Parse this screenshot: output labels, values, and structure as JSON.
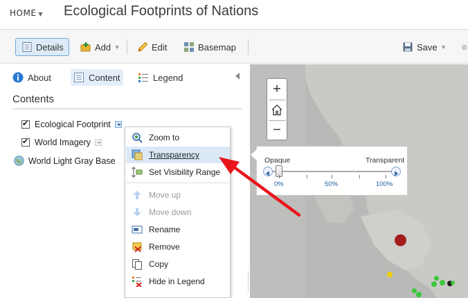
{
  "header": {
    "home_label": "HOME",
    "title": "Ecological Footprints of Nations"
  },
  "toolbar": {
    "details_label": "Details",
    "add_label": "Add",
    "edit_label": "Edit",
    "basemap_label": "Basemap",
    "save_label": "Save"
  },
  "panel": {
    "tabs": {
      "about": "About",
      "content": "Content",
      "legend": "Legend"
    },
    "section_title": "Contents",
    "layers": [
      {
        "name": "Ecological Footprint",
        "checked": true
      },
      {
        "name": "World Imagery",
        "checked": true
      },
      {
        "name": "World Light Gray Base"
      }
    ]
  },
  "context_menu": {
    "items": [
      {
        "label": "Zoom to",
        "icon": "zoom-to-icon",
        "enabled": true
      },
      {
        "label": "Transparency",
        "icon": "transparency-icon",
        "enabled": true,
        "highlighted": true
      },
      {
        "label": "Set Visibility Range",
        "icon": "visibility-range-icon",
        "enabled": true
      },
      {
        "label": "Move up",
        "icon": "move-up-icon",
        "enabled": false
      },
      {
        "label": "Move down",
        "icon": "move-down-icon",
        "enabled": false
      },
      {
        "label": "Rename",
        "icon": "rename-icon",
        "enabled": true
      },
      {
        "label": "Remove",
        "icon": "remove-icon",
        "enabled": true
      },
      {
        "label": "Copy",
        "icon": "copy-icon",
        "enabled": true
      },
      {
        "label": "Hide in Legend",
        "icon": "hide-in-legend-icon",
        "enabled": true
      }
    ]
  },
  "transparency": {
    "opaque_label": "Opaque",
    "transparent_label": "Transparent",
    "ticks": [
      "0%",
      "50%",
      "100%"
    ],
    "value_percent": 0
  },
  "map": {
    "zoom_in": "+",
    "zoom_out": "−",
    "markers": [
      {
        "color": "#a31d1d"
      },
      {
        "color": "#f0d000"
      },
      {
        "color": "#3cc63c"
      },
      {
        "color": "#1e1e1e"
      }
    ]
  },
  "colors": {
    "accent": "#6fa8d9",
    "arrow": "#e8141a",
    "highlight": "#dbe9f7"
  }
}
